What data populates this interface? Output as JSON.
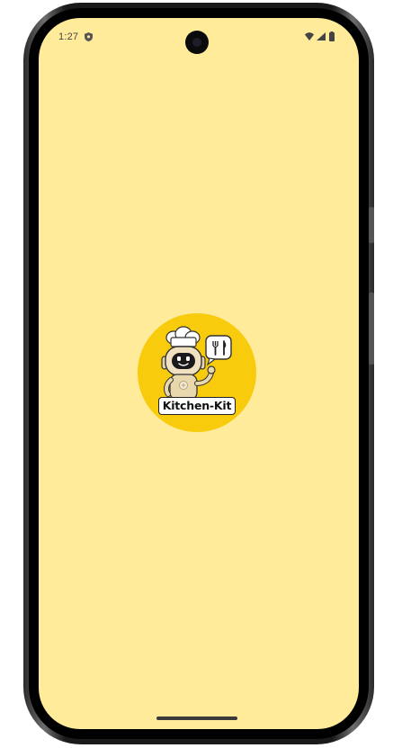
{
  "status_bar": {
    "time": "1:27",
    "icons": [
      "shield-icon",
      "wifi-icon",
      "signal-icon",
      "battery-icon"
    ]
  },
  "splash": {
    "logo_text": "Kitchen-Kit",
    "background_color": "#ffeb99",
    "logo_circle_color": "#f8cc0c",
    "logo_icons": [
      "chef-robot-icon",
      "fork-knife-icon"
    ]
  }
}
